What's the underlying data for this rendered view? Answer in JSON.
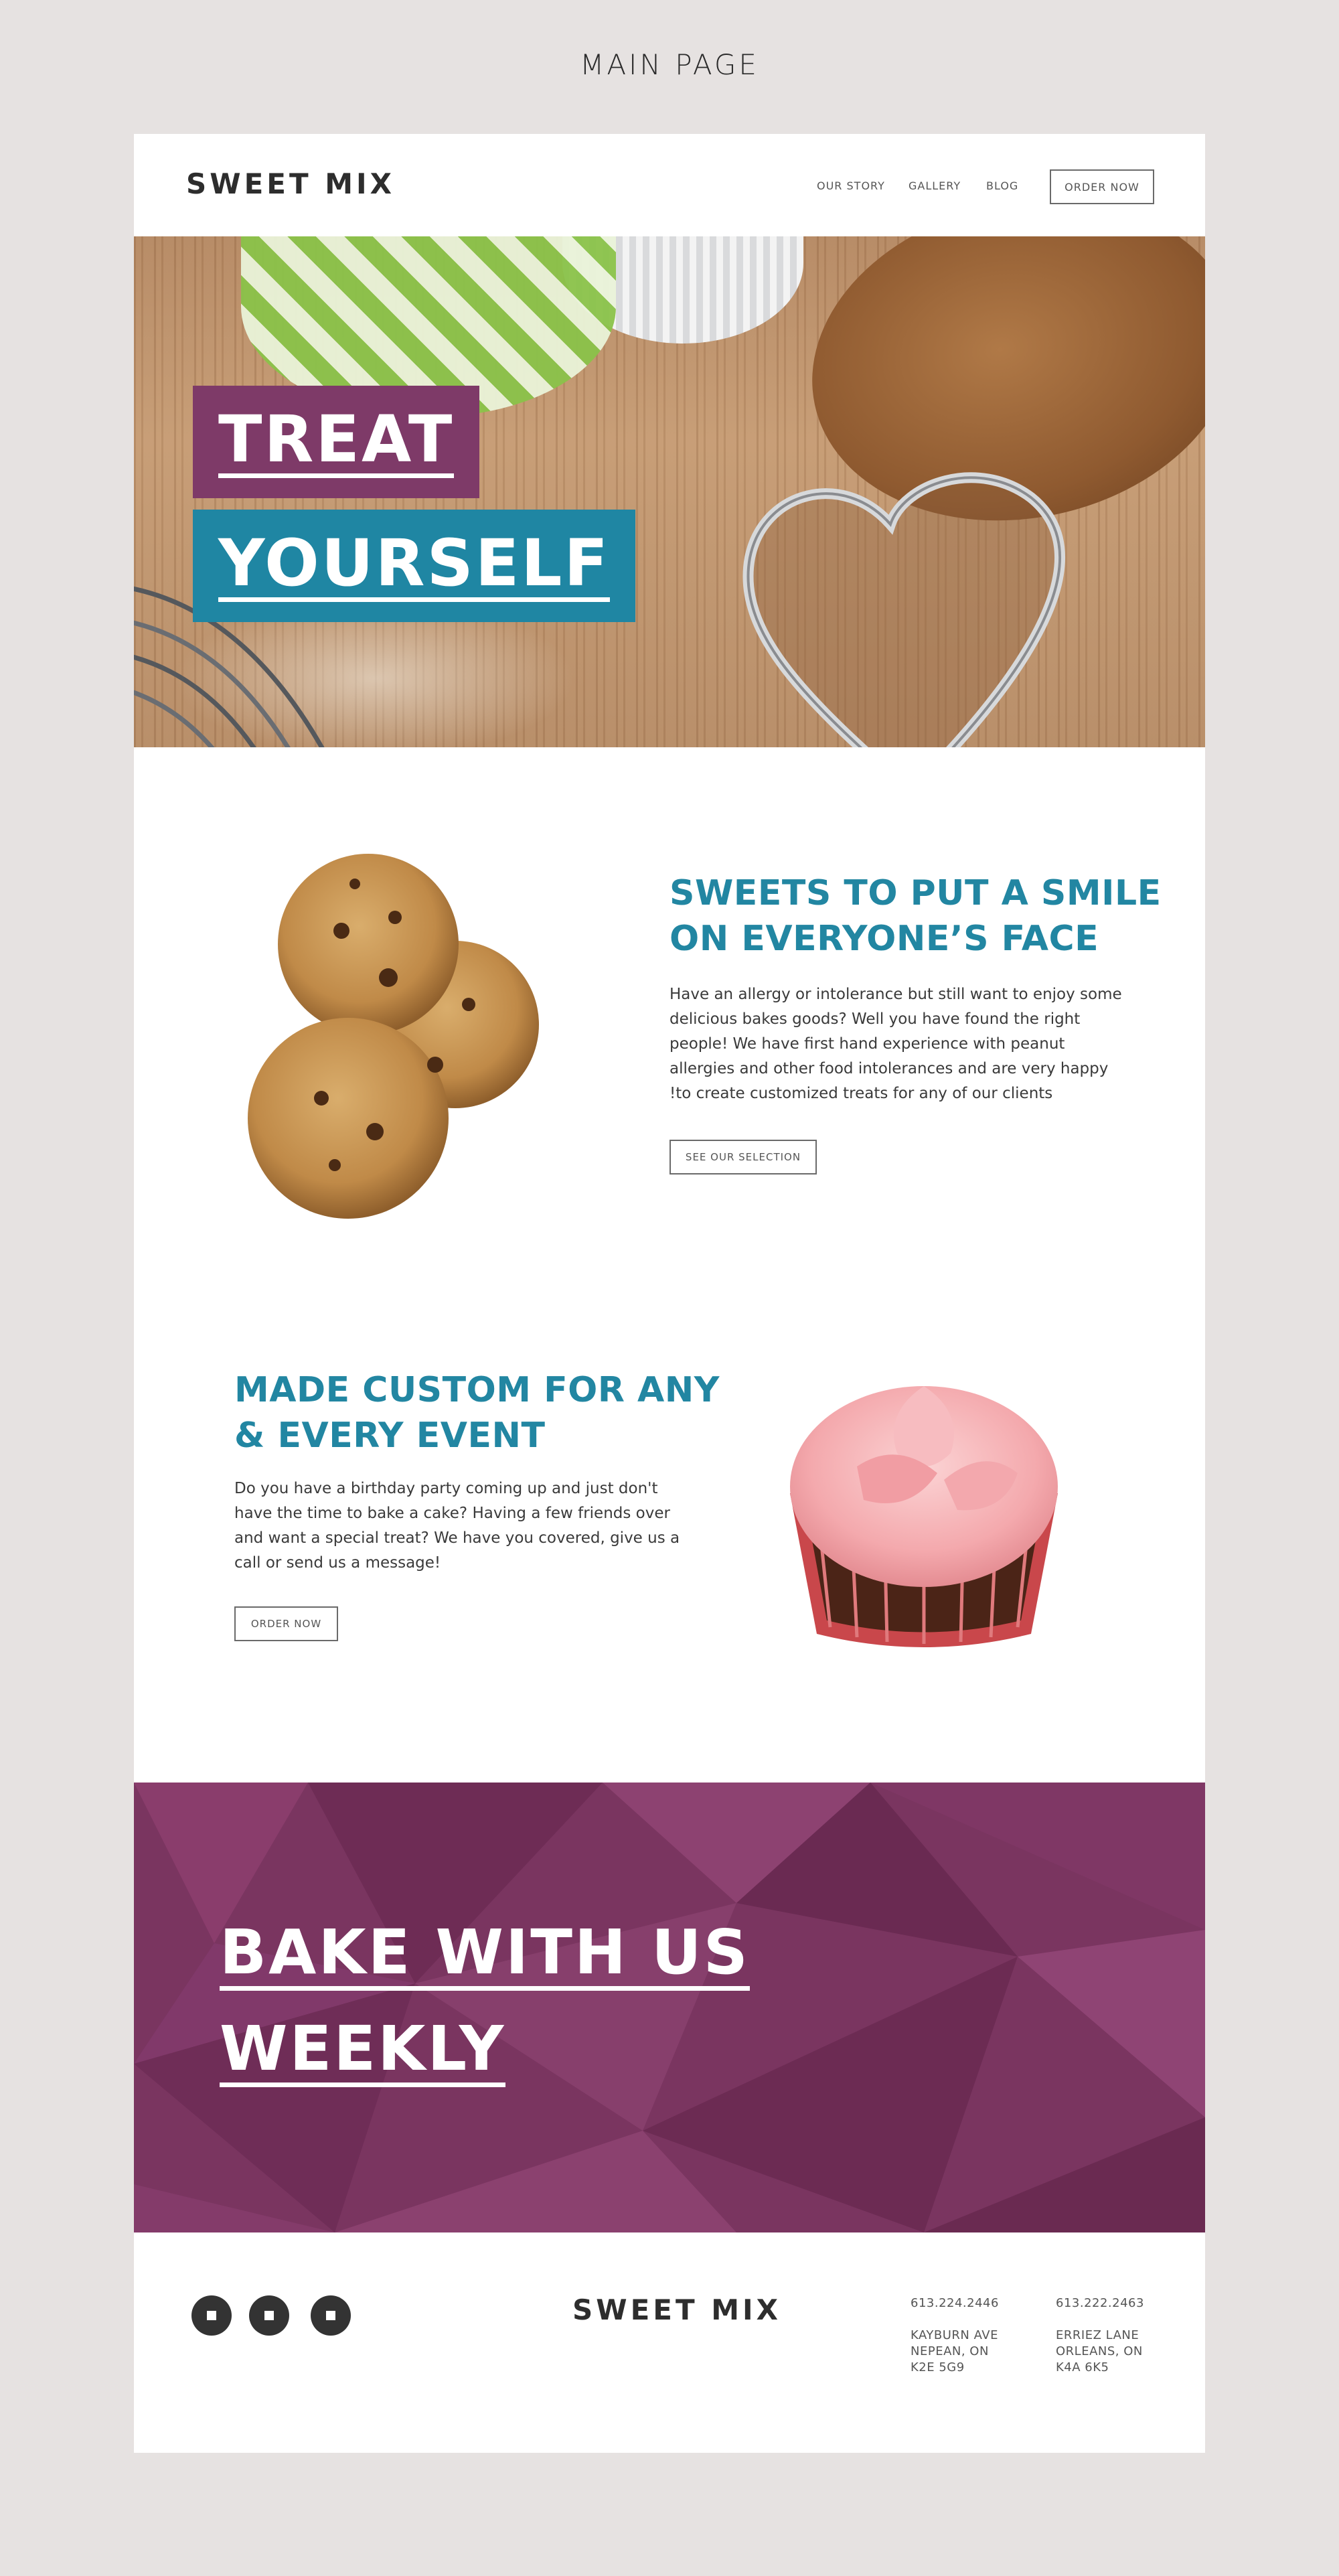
{
  "page_label": "MAIN PAGE",
  "header": {
    "logo": "SWEET MIX",
    "nav": [
      "OUR STORY",
      "GALLERY",
      "BLOG"
    ],
    "order_button": "ORDER NOW"
  },
  "hero": {
    "line1": "TREAT",
    "line2": "YOURSELF",
    "colors": {
      "line1_bg": "#7e3a68",
      "line2_bg": "#1f86a3"
    }
  },
  "section_sweets": {
    "heading_line1": "SWEETS TO PUT A SMILE",
    "heading_line2": "ON EVERYONE’S FACE",
    "body": [
      "Have an allergy or intolerance but still want to enjoy some",
      "delicious bakes goods? Well you have found the right",
      "people! We have first hand experience with peanut",
      "allergies and other food intolerances and are very happy",
      "!to create customized treats for any of our clients"
    ],
    "button": "SEE OUR SELECTION",
    "image_icon": "cookies-image"
  },
  "section_custom": {
    "heading_line1": "MADE CUSTOM FOR ANY",
    "heading_line2": "& EVERY EVENT",
    "body": [
      "Do you have a birthday party coming up and just don't",
      "have the time to bake a cake? Having a few friends over",
      "and want a special treat? We have you covered, give us a",
      "call or send us a message!"
    ],
    "button": "ORDER NOW",
    "image_icon": "cupcake-image"
  },
  "banner": {
    "line1": "BAKE WITH US",
    "line2": "WEEKLY",
    "color": "#7a3560"
  },
  "footer": {
    "logo": "SWEET MIX",
    "social_icons": [
      "social-icon-1",
      "social-icon-2",
      "social-icon-3"
    ],
    "locations": [
      {
        "phone": "613.224.2446",
        "street": "KAYBURN AVE",
        "city": "NEPEAN, ON",
        "postal": "K2E 5G9"
      },
      {
        "phone": "613.222.2463",
        "street": "ERRIEZ LANE",
        "city": "ORLEANS, ON",
        "postal": "K4A 6K5"
      }
    ]
  },
  "colors": {
    "accent_blue": "#2286a2",
    "accent_plum": "#7e3a68",
    "background": "#e6e2e1"
  }
}
